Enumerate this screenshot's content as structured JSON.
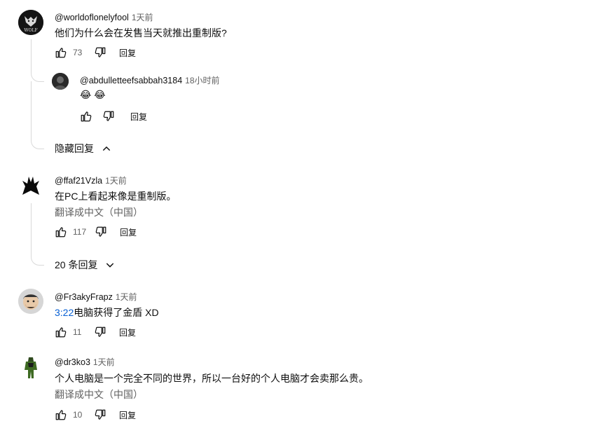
{
  "comments": [
    {
      "author": "@worldoflonelyfool",
      "time": "1天前",
      "text": "他们为什么会在发售当天就推出重制版?",
      "likes": "73",
      "reply_label": "回复",
      "avatar_text": "WOLF",
      "replies_toggle": "隐藏回复",
      "replies": [
        {
          "author": "@abdulletteefsabbah3184",
          "time": "18小时前",
          "text": "😂 😂",
          "reply_label": "回复"
        }
      ]
    },
    {
      "author": "@ffaf21Vzla",
      "time": "1天前",
      "text": "在PC上看起来像是重制版。",
      "translate": "翻译成中文（中国）",
      "likes": "117",
      "reply_label": "回复",
      "replies_toggle": "20 条回复"
    },
    {
      "author": "@Fr3akyFrapz",
      "time": "1天前",
      "timestamp_link": "3:22",
      "text": "电脑获得了金盾 XD",
      "likes": "11",
      "reply_label": "回复"
    },
    {
      "author": "@dr3ko3",
      "time": "1天前",
      "text": "个人电脑是一个完全不同的世界，所以一台好的个人电脑才会卖那么贵。",
      "translate": "翻译成中文（中国）",
      "likes": "10",
      "reply_label": "回复"
    }
  ]
}
